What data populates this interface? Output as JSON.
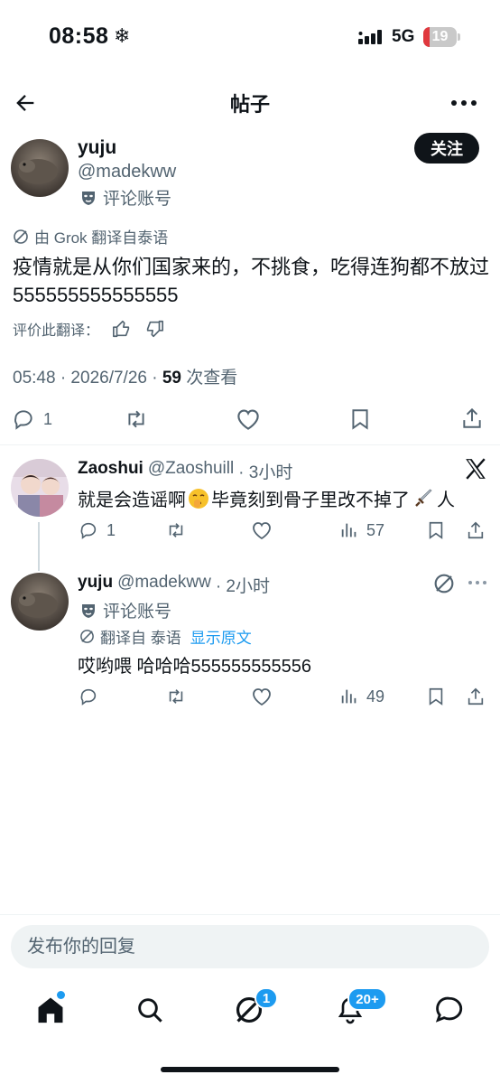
{
  "status_bar": {
    "time": "08:58",
    "snow": "❄",
    "network": "5G",
    "battery": "19"
  },
  "header": {
    "title": "帖子"
  },
  "main_post": {
    "name": "yuju",
    "handle": "@madekww",
    "account_label": "评论账号",
    "follow_label": "关注",
    "translated_by": "由 Grok 翻译自泰语",
    "text": "疫情就是从你们国家来的，不挑食，吃得连狗都不放过555555555555555",
    "rate_label": "评价此翻译：",
    "time": "05:48 · 2026/7/26 · ",
    "views": "59",
    "views_label": " 次查看",
    "reply_count": "1"
  },
  "replies": [
    {
      "name": "Zaoshui",
      "handle": "@Zaoshuill",
      "time": "· 3小时",
      "text": "就是会造谣啊",
      "text_after": "毕竟刻到骨子里改不掉了",
      "text_tail": "人",
      "reply_count": "1",
      "views": "57"
    },
    {
      "name": "yuju",
      "handle": "@madekww",
      "time": "· 2小时",
      "account_label": "评论账号",
      "translated_label": "翻译自 泰语",
      "show_original": "显示原文",
      "text": "哎哟喂 哈哈哈555555555556",
      "views": "49"
    }
  ],
  "composer": {
    "placeholder": "发布你的回复"
  },
  "nav": {
    "grok_badge": "1",
    "notifications_badge": "20+"
  },
  "colors": {
    "accent": "#1d9bf0",
    "text": "#0f1419",
    "secondary": "#536471"
  }
}
